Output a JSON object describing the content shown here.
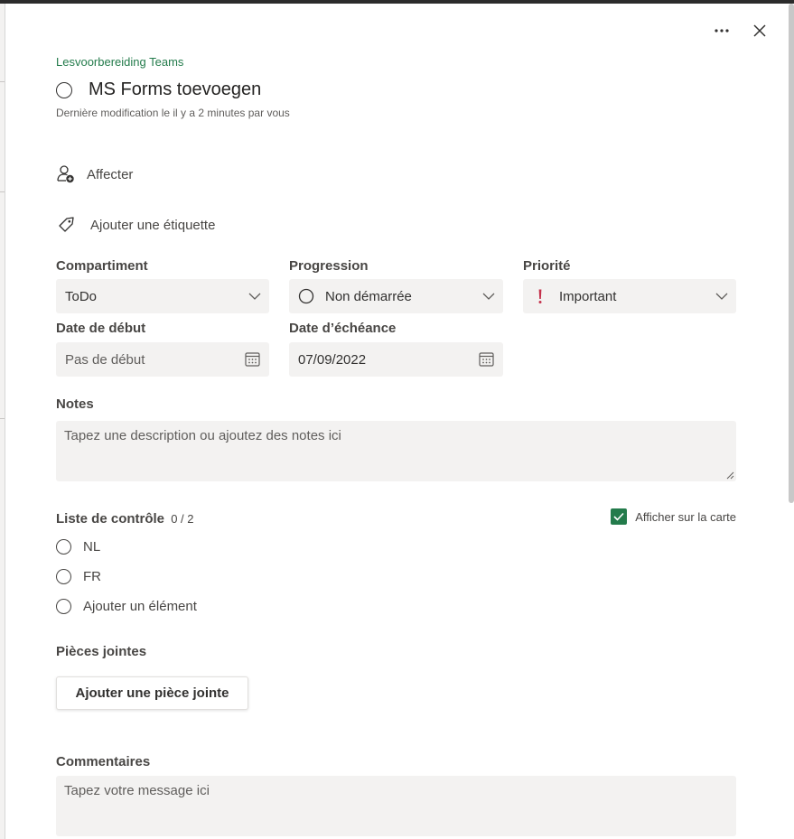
{
  "header": {
    "more_icon": "more-horizontal-icon",
    "close_icon": "close-icon"
  },
  "task": {
    "plan_name": "Lesvoorbereiding Teams",
    "title": "MS Forms toevoegen",
    "last_modified": "Dernière modification le il y a 2 minutes par vous"
  },
  "actions": {
    "assign_label": "Affecter",
    "add_label_label": "Ajouter une étiquette"
  },
  "fields": {
    "bucket": {
      "label": "Compartiment",
      "value": "ToDo"
    },
    "progress": {
      "label": "Progression",
      "value": "Non démarrée"
    },
    "priority": {
      "label": "Priorité",
      "value": "Important",
      "icon_color": "#c4314b"
    },
    "start_date": {
      "label": "Date de début",
      "placeholder": "Pas de début"
    },
    "due_date": {
      "label": "Date d’échéance",
      "value": "07/09/2022"
    }
  },
  "notes": {
    "label": "Notes",
    "placeholder": "Tapez une description ou ajoutez des notes ici"
  },
  "checklist": {
    "label": "Liste de contrôle",
    "count": "0 / 2",
    "show_on_card_label": "Afficher sur la carte",
    "show_on_card_checked": true,
    "items": [
      {
        "text": "NL"
      },
      {
        "text": "FR"
      }
    ],
    "add_item_label": "Ajouter un élément"
  },
  "attachments": {
    "label": "Pièces jointes",
    "add_button_label": "Ajouter une pièce jointe"
  },
  "comments": {
    "label": "Commentaires",
    "placeholder": "Tapez votre message ici"
  },
  "colors": {
    "accent_green": "#237b4b",
    "field_bg": "#f3f2f1",
    "priority_red": "#c4314b"
  }
}
